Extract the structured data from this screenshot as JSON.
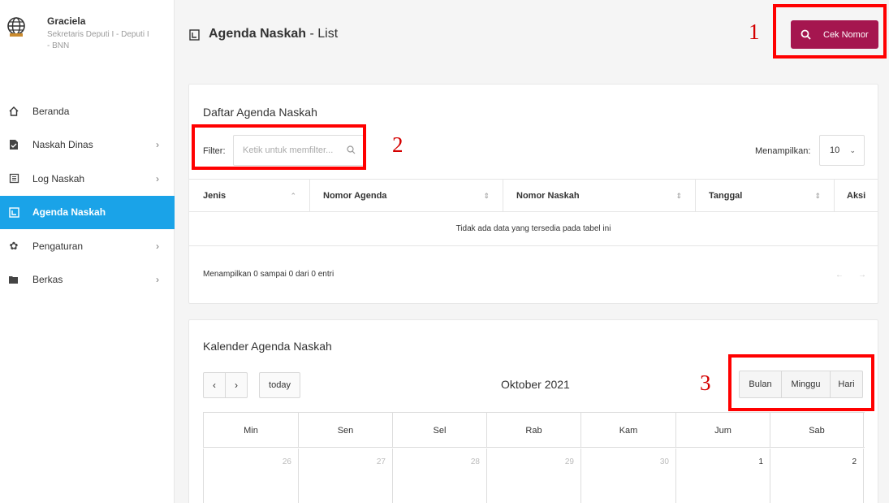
{
  "profile": {
    "name": "Graciela",
    "role": "Sekretaris Deputi I - Deputi I - BNN"
  },
  "sidebar": {
    "items": [
      {
        "label": "Beranda",
        "icon": "home-icon",
        "chevron": ""
      },
      {
        "label": "Naskah Dinas",
        "icon": "document-icon",
        "chevron": "›"
      },
      {
        "label": "Log Naskah",
        "icon": "log-icon",
        "chevron": "›"
      },
      {
        "label": "Agenda Naskah",
        "icon": "agenda-icon",
        "chevron": ""
      },
      {
        "label": "Pengaturan",
        "icon": "gear-icon",
        "chevron": "›"
      },
      {
        "label": "Berkas",
        "icon": "folder-icon",
        "chevron": "›"
      }
    ],
    "active_index": 3,
    "active_color": "#1aa3e8"
  },
  "header": {
    "title_bold": "Agenda Naskah",
    "title_rest": " - List"
  },
  "cek_nomor": {
    "label": "Cek Nomor",
    "color": "#a5164f"
  },
  "annotations": {
    "m1": "1",
    "m2": "2",
    "m3": "3"
  },
  "list_card": {
    "title": "Daftar Agenda Naskah",
    "filter_label": "Filter:",
    "filter_placeholder": "Ketik untuk memfilter...",
    "show_label": "Menampilkan:",
    "show_value": "10",
    "columns": [
      "Jenis",
      "Nomor Agenda",
      "Nomor Naskah",
      "Tanggal",
      "Aksi"
    ],
    "empty_text": "Tidak ada data yang tersedia pada tabel ini",
    "info_text": "Menampilkan 0 sampai 0 dari 0 entri",
    "prev": "←",
    "next": "→"
  },
  "calendar": {
    "title": "Kalender Agenda Naskah",
    "prev": "‹",
    "next": "›",
    "today": "today",
    "month": "Oktober 2021",
    "views": [
      "Bulan",
      "Minggu",
      "Hari"
    ],
    "days": [
      "Min",
      "Sen",
      "Sel",
      "Rab",
      "Kam",
      "Jum",
      "Sab"
    ],
    "first_week": [
      "26",
      "27",
      "28",
      "29",
      "30",
      "1",
      "2"
    ]
  }
}
